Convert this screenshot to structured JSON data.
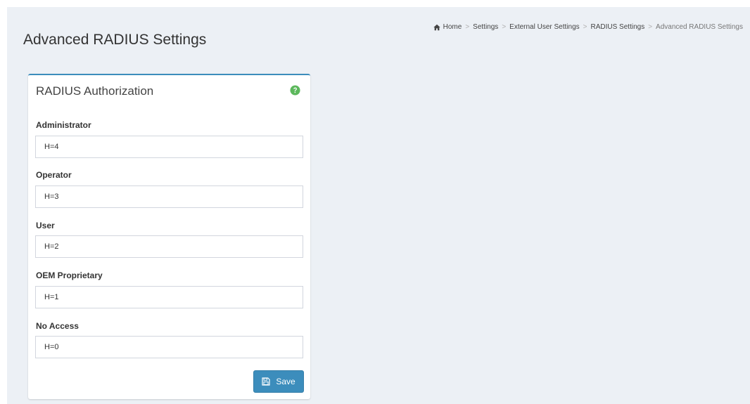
{
  "page": {
    "title": "Advanced RADIUS Settings"
  },
  "breadcrumb": {
    "items": [
      "Home",
      "Settings",
      "External User Settings",
      "RADIUS Settings"
    ],
    "active": "Advanced RADIUS Settings",
    "separator": ">",
    "home_icon": "home-icon"
  },
  "panel": {
    "title": "RADIUS Authorization",
    "help_icon": "question-circle-icon",
    "help_color": "#5cb85c",
    "fields": [
      {
        "label": "Administrator",
        "value": "H=4"
      },
      {
        "label": "Operator",
        "value": "H=3"
      },
      {
        "label": "User",
        "value": "H=2"
      },
      {
        "label": "OEM Proprietary",
        "value": "H=1"
      },
      {
        "label": "No Access",
        "value": "H=0"
      }
    ],
    "save_label": "Save",
    "save_icon": "floppy-disk-icon"
  },
  "colors": {
    "accent": "#3c8dbc",
    "background": "#ecf0f5"
  }
}
